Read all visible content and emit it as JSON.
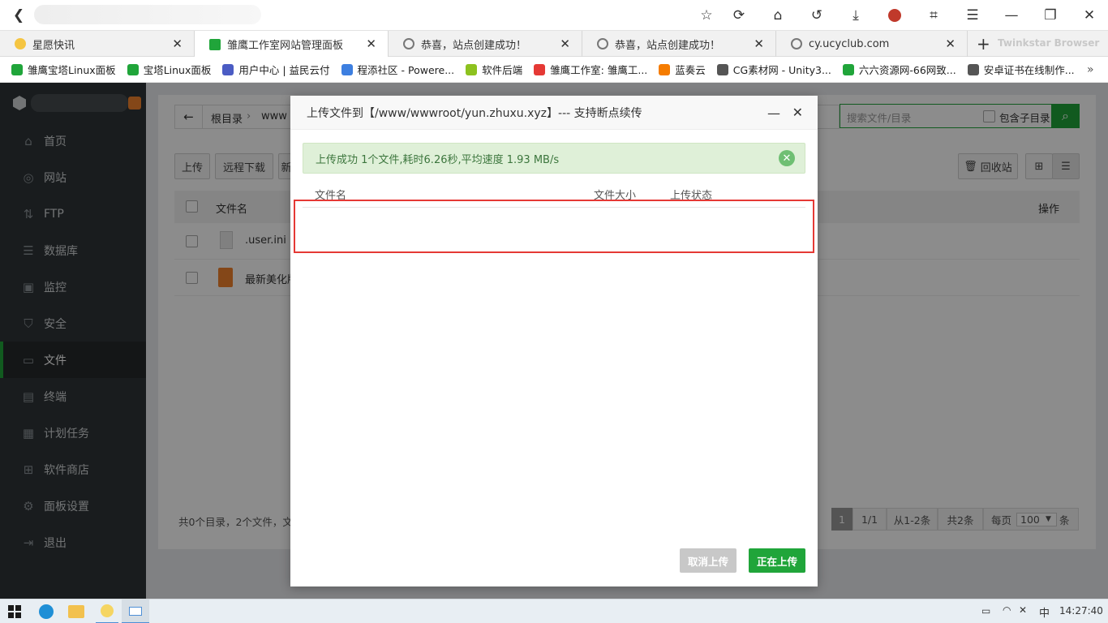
{
  "browser": {
    "tabs": [
      {
        "title": "星愿快讯",
        "icon_color": "#f5c542"
      },
      {
        "title": "雏鹰工作室网站管理面板",
        "icon_color": "#20a53a",
        "active": true
      },
      {
        "title": "恭喜，站点创建成功！",
        "icon_color": "#888888"
      },
      {
        "title": "恭喜，站点创建成功！",
        "icon_color": "#888888"
      },
      {
        "title": "cy.ucyclub.com",
        "icon_color": "#888888"
      }
    ],
    "brand": "Twinkstar Browser",
    "bookmarks": [
      {
        "title": "雏鹰宝塔Linux面板",
        "icon_color": "#20a53a"
      },
      {
        "title": "宝塔Linux面板",
        "icon_color": "#20a53a"
      },
      {
        "title": "用户中心 | 益民云付",
        "icon_color": "#4b5cc4"
      },
      {
        "title": "程添社区 - Powere...",
        "icon_color": "#3d7fe0"
      },
      {
        "title": "软件后端",
        "icon_color": "#8dc21f"
      },
      {
        "title": "雏鹰工作室: 雏鹰工...",
        "icon_color": "#e53935"
      },
      {
        "title": "蓝奏云",
        "icon_color": "#f57c00"
      },
      {
        "title": "CG素材网 - Unity3...",
        "icon_color": "#555555"
      },
      {
        "title": "六六资源网-66网致...",
        "icon_color": "#20a53a"
      },
      {
        "title": "安卓证书在线制作...",
        "icon_color": "#555555"
      }
    ]
  },
  "sidebar": {
    "items": [
      {
        "label": "首页",
        "icon": "home-icon",
        "glyph": "⌂"
      },
      {
        "label": "网站",
        "icon": "globe-icon",
        "glyph": "◎"
      },
      {
        "label": "FTP",
        "icon": "ftp-icon",
        "glyph": "⇅"
      },
      {
        "label": "数据库",
        "icon": "database-icon",
        "glyph": "☰"
      },
      {
        "label": "监控",
        "icon": "monitor-icon",
        "glyph": "▣"
      },
      {
        "label": "安全",
        "icon": "shield-icon",
        "glyph": "⛉"
      },
      {
        "label": "文件",
        "icon": "folder-icon",
        "glyph": "▭",
        "active": true
      },
      {
        "label": "终端",
        "icon": "terminal-icon",
        "glyph": "▤"
      },
      {
        "label": "计划任务",
        "icon": "calendar-icon",
        "glyph": "▦"
      },
      {
        "label": "软件商店",
        "icon": "apps-icon",
        "glyph": "⊞"
      },
      {
        "label": "面板设置",
        "icon": "gear-icon",
        "glyph": "⚙"
      },
      {
        "label": "退出",
        "icon": "logout-icon",
        "glyph": "⇥"
      }
    ]
  },
  "files": {
    "breadcrumb_root": "根目录",
    "breadcrumb_dir": "www",
    "search_placeholder": "搜索文件/目录",
    "include_subdir": "包含子目录",
    "toolbar": {
      "upload": "上传",
      "remote_download": "远程下载",
      "new": "新",
      "recycle": "回收站"
    },
    "col_name": "文件名",
    "col_ops": "操作",
    "rows": [
      {
        "name": ".user.ini"
      },
      {
        "name": "最新美化版"
      }
    ],
    "summary": "共0个目录，2个文件，文",
    "pagination": {
      "current": "1",
      "pages": "1/1",
      "range": "从1-2条",
      "total": "共2条",
      "per_page_label": "每页",
      "per_page": "100",
      "unit": "条"
    }
  },
  "modal": {
    "title": "上传文件到【/www/wwwroot/yun.zhuxu.xyz】--- 支持断点续传",
    "alert": "上传成功 1个文件,耗时6.26秒,平均速度 1.93 MB/s",
    "col_name": "文件名",
    "col_size": "文件大小",
    "col_status": "上传状态",
    "cancel_button": "取消上传",
    "uploading_button": "正在上传"
  },
  "taskbar": {
    "ime": "中",
    "time": "14:27:40"
  }
}
